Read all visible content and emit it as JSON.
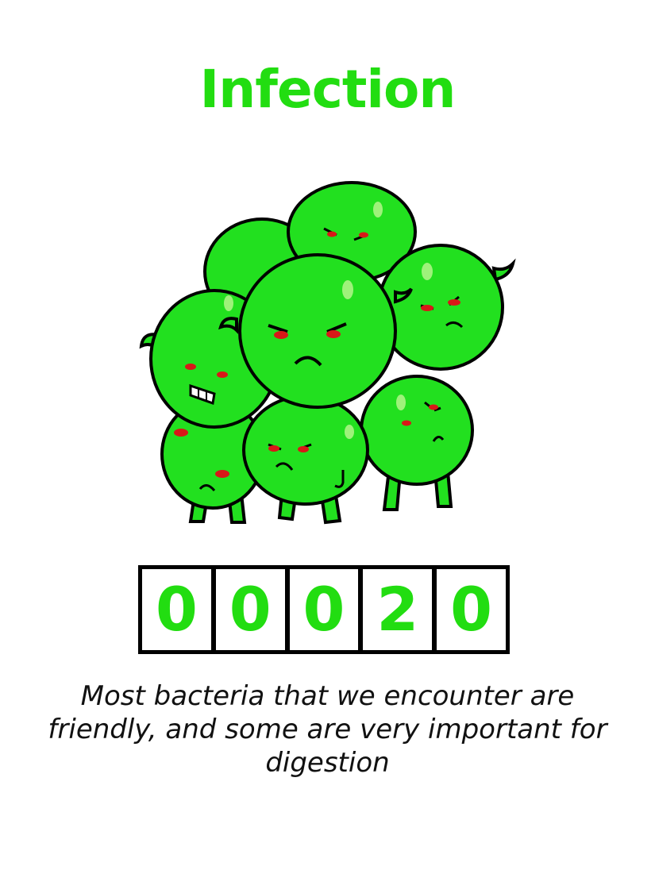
{
  "card": {
    "title": "Infection",
    "counter_digits": [
      "0",
      "0",
      "0",
      "2",
      "0"
    ],
    "description": "Most bacteria that we encounter are friendly, and some are very important for digestion"
  },
  "illustration": {
    "icon": "angry-bacteria-cluster-icon"
  },
  "colors": {
    "accent": "#22dd11",
    "bacteria_body": "#22e01f",
    "bacteria_shade": "#18b818",
    "outline": "#000000",
    "eyes": "#d81818"
  }
}
